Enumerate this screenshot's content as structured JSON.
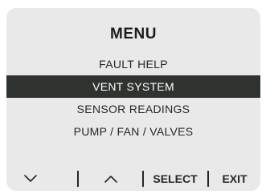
{
  "menu": {
    "title": "MENU",
    "items": [
      {
        "label": "FAULT HELP",
        "selected": false
      },
      {
        "label": "VENT SYSTEM",
        "selected": true
      },
      {
        "label": "SENSOR READINGS",
        "selected": false
      },
      {
        "label": "PUMP / FAN / VALVES",
        "selected": false
      }
    ]
  },
  "softkeys": {
    "down_icon": "chevron-down-icon",
    "up_icon": "chevron-up-icon",
    "select_label": "SELECT",
    "exit_label": "EXIT"
  },
  "colors": {
    "screen_background": "#e9e9e9",
    "highlight_background": "#2f3330",
    "highlight_text": "#ffffff",
    "text": "#262626"
  }
}
